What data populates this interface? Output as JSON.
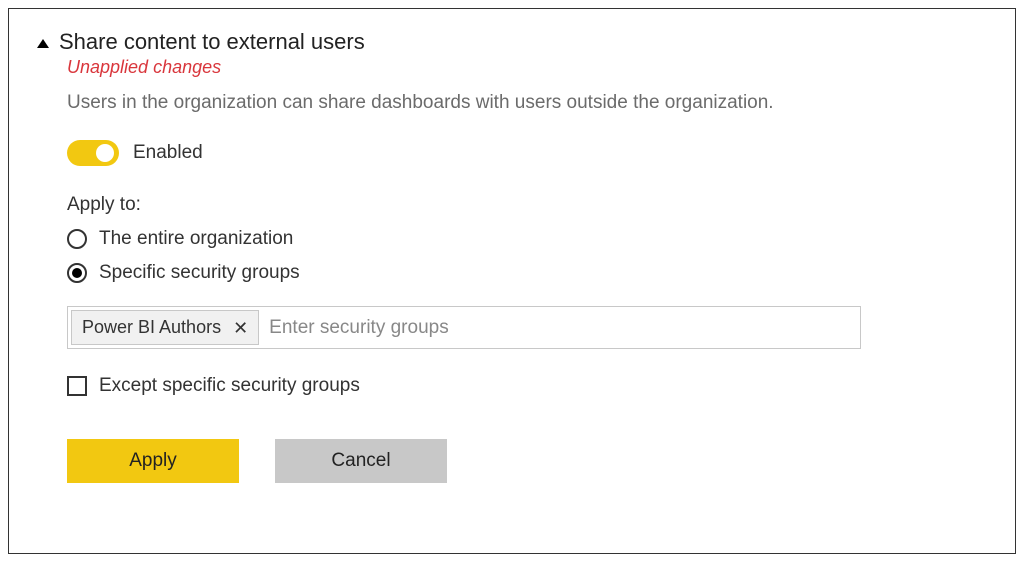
{
  "setting": {
    "title": "Share content to external users",
    "unapplied_label": "Unapplied changes",
    "description": "Users in the organization can share dashboards with users outside the organization.",
    "toggle": {
      "enabled": true,
      "label": "Enabled"
    },
    "apply_to": {
      "label": "Apply to:",
      "options": [
        {
          "label": "The entire organization",
          "selected": false
        },
        {
          "label": "Specific security groups",
          "selected": true
        }
      ]
    },
    "security_groups": {
      "tags": [
        "Power BI Authors"
      ],
      "placeholder": "Enter security groups"
    },
    "except_checkbox": {
      "checked": false,
      "label": "Except specific security groups"
    },
    "buttons": {
      "apply_label": "Apply",
      "cancel_label": "Cancel"
    }
  },
  "colors": {
    "accent": "#f2c811",
    "warning_text": "#d9363c"
  }
}
